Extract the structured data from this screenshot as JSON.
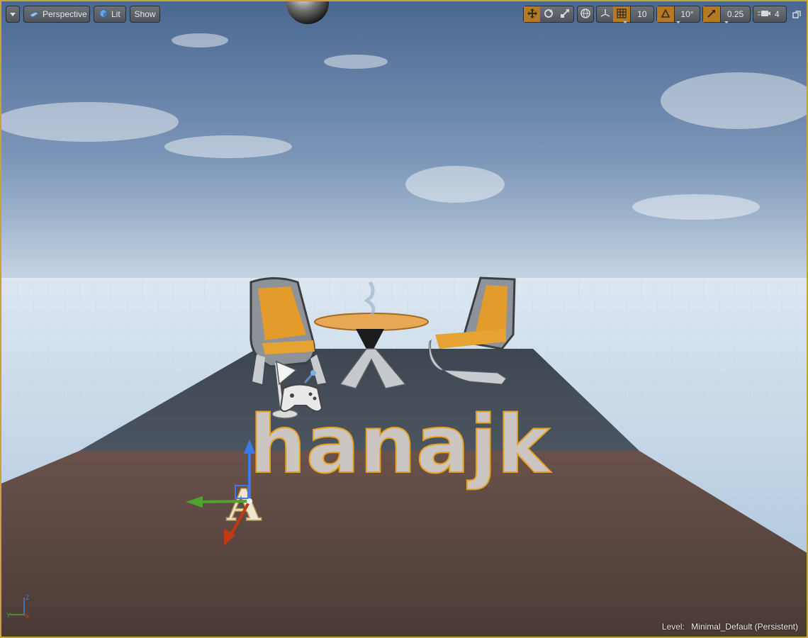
{
  "toolbar": {
    "view_mode": "Perspective",
    "lighting": "Lit",
    "show": "Show",
    "grid_snap": "10",
    "rotation_snap": "10°",
    "scale_snap": "0.25",
    "camera_speed": "4"
  },
  "scene": {
    "text_actor": "hanajk",
    "text_actor_small": "A",
    "axis_labels": {
      "z": "Z",
      "x": "X",
      "y": "Y"
    }
  },
  "status": {
    "level_label": "Level:",
    "level_name": "Minimal_Default (Persistent)"
  },
  "colors": {
    "accent": "#b5791f",
    "selection_outline": "#e8a11f",
    "floor_dark": "#4a5560",
    "floor_brown": "#5e4a44",
    "sky_top": "#4f6d96",
    "chair_cushion": "#e59f2d"
  },
  "icons": [
    "chevron-down-icon",
    "perspective-cube-icon",
    "lit-cube-icon",
    "translate-icon",
    "rotate-icon",
    "scale-icon",
    "world-icon",
    "surface-snap-icon",
    "grid-icon",
    "rotation-snap-icon",
    "scale-snap-icon",
    "camera-speed-icon",
    "maximize-icon",
    "gamepad-icon",
    "flag-icon"
  ]
}
